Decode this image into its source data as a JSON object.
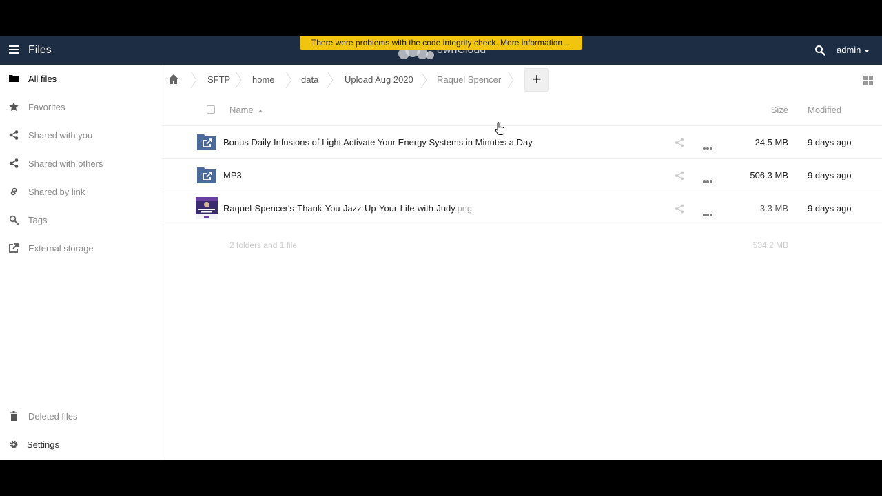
{
  "header": {
    "app_title": "Files",
    "logo_text": "ownCloud",
    "warning": "There were problems with the code integrity check. More information…",
    "user": "admin",
    "bg_color": "#1d2d44",
    "warning_color": "#f1c40f"
  },
  "sidebar": {
    "items": [
      {
        "label": "All files",
        "icon": "folder-icon"
      },
      {
        "label": "Favorites",
        "icon": "star-icon"
      },
      {
        "label": "Shared with you",
        "icon": "share-icon"
      },
      {
        "label": "Shared with others",
        "icon": "share-icon"
      },
      {
        "label": "Shared by link",
        "icon": "link-icon"
      },
      {
        "label": "Tags",
        "icon": "tag-icon"
      },
      {
        "label": "External storage",
        "icon": "external-icon"
      }
    ],
    "bottom": [
      {
        "label": "Deleted files",
        "icon": "trash-icon"
      },
      {
        "label": "Settings",
        "icon": "gear-icon"
      }
    ]
  },
  "breadcrumbs": [
    "SFTP",
    "home",
    "data",
    "Upload Aug 2020",
    "Raquel Spencer"
  ],
  "new_button": "+",
  "table": {
    "headers": {
      "name": "Name",
      "size": "Size",
      "modified": "Modified"
    },
    "rows": [
      {
        "name": "Bonus Daily Infusions of Light Activate Your Energy Systems in Minutes a Day",
        "ext": "",
        "type": "external-folder",
        "size": "24.5 MB",
        "modified": "9 days ago"
      },
      {
        "name": "MP3",
        "ext": "",
        "type": "external-folder",
        "size": "506.3 MB",
        "modified": "9 days ago"
      },
      {
        "name": "Raquel-Spencer's-Thank-You-Jazz-Up-Your-Life-with-Judy",
        "ext": ".png",
        "type": "image",
        "size": "3.3 MB",
        "modified": "9 days ago"
      }
    ],
    "summary": {
      "text": "2 folders and 1 file",
      "size": "534.2 MB"
    }
  }
}
